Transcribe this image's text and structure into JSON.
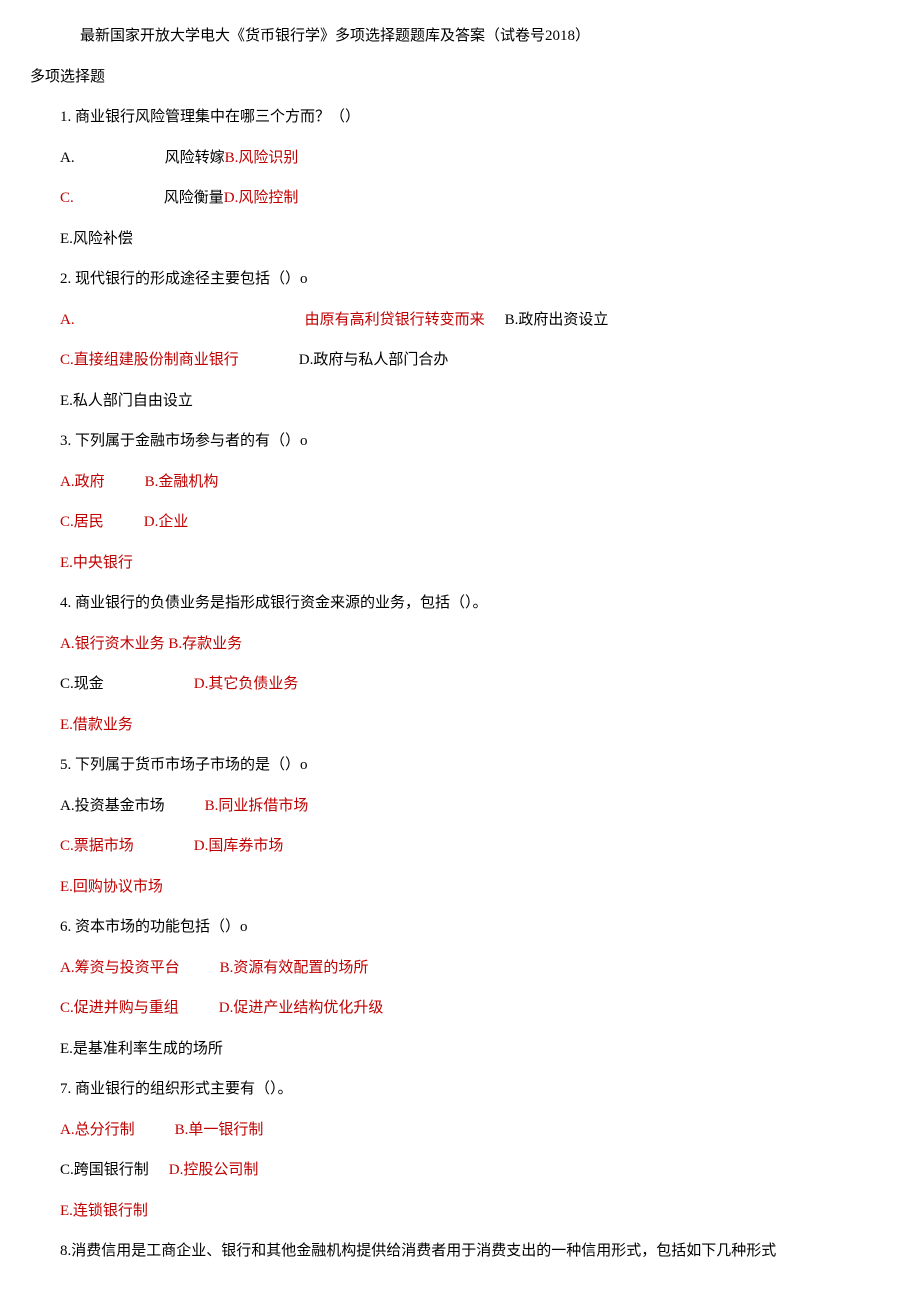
{
  "title": "最新国家开放大学电大《货币银行学》多项选择题题库及答案（试卷号2018）",
  "section": "多项选择题",
  "q1": {
    "stem": "1. 商业银行风险管理集中在哪三个方而？（）",
    "A_label": "A.",
    "A_text": "风险转嫁",
    "B": "B.风险识别",
    "C_label": "C.",
    "C_text": "风险衡量",
    "D": "D.风险控制",
    "E": "E.风险补偿"
  },
  "q2": {
    "stem": "2. 现代银行的形成途径主要包括（）o",
    "A_label": "A.",
    "A_text": "由原有高利贷银行转变而来",
    "B": "B.政府出资设立",
    "C": "C.直接组建股份制商业银行",
    "D": "D.政府与私人部门合办",
    "E": "E.私人部门自由设立"
  },
  "q3": {
    "stem": "3. 下列属于金融市场参与者的有（）o",
    "A": "A.政府",
    "B": "B.金融机构",
    "C": "C.居民",
    "D": "D.企业",
    "E": "E.中央银行"
  },
  "q4": {
    "stem": "4. 商业银行的负债业务是指形成银行资金来源的业务，包括（）。",
    "A": "A.银行资木业务",
    "B": "B.存款业务",
    "C": "C.现金",
    "D": "D.其它负债业务",
    "E": "E.借款业务"
  },
  "q5": {
    "stem": "5. 下列属于货币市场子市场的是（）o",
    "A": "A.投资基金市场",
    "B": "B.同业拆借市场",
    "C": "C.票据市场",
    "D": "D.国库券市场",
    "E": "E.回购协议市场"
  },
  "q6": {
    "stem": "6. 资本市场的功能包括（）o",
    "A": "A.筹资与投资平台",
    "B": "B.资源有效配置的场所",
    "C": "C.促进并购与重组",
    "D": "D.促进产业结构优化升级",
    "E": "E.是基准利率生成的场所"
  },
  "q7": {
    "stem": "7. 商业银行的组织形式主要有（）。",
    "A": "A.总分行制",
    "B": "B.单一银行制",
    "C": "C.跨国银行制",
    "D": "D.控股公司制",
    "E": "E.连锁银行制"
  },
  "q8": {
    "stem": "8.消费信用是工商企业、银行和其他金融机构提供给消费者用于消费支出的一种信用形式，包括如下几种形式"
  }
}
